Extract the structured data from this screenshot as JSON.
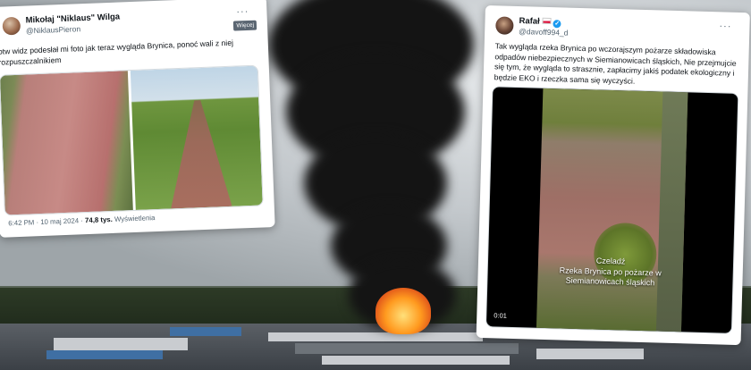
{
  "left_tweet": {
    "author_name": "Mikołaj \"Niklaus\" Wilga",
    "author_handle": "@NiklausPieron",
    "more_label": "···",
    "tooltip": "Więcej",
    "text": "otw widz podesłał mi foto jak teraz wygląda Brynica, ponoć wali z niej rozpuszczalnikiem",
    "time": "6:42 PM · 10 maj 2024 · ",
    "views_count": "74,8 tys.",
    "views_label": " Wyświetlenia"
  },
  "right_tweet": {
    "author_name": "Rafał",
    "author_handle": "@davoff994_d",
    "more_label": "···",
    "text": "Tak wygląda rzeka Brynica po wczorajszym pożarze składowiska odpadów niebezpiecznych w Siemianowicach śląskich, Nie przejmujcie się tym, że wygląda to strasznie, zapłacimy jakiś podatek ekologiczny i będzie EKO i rzeczka sama się wyczyści.",
    "video_caption_line1": "Czeladź",
    "video_caption_line2": "Rzeka Brynica po pożarze w",
    "video_caption_line3": "Siemianowicach śląskich",
    "video_time": "0:01"
  },
  "colors": {
    "verified": "#1d9bf0",
    "secondary_text": "#536471"
  }
}
